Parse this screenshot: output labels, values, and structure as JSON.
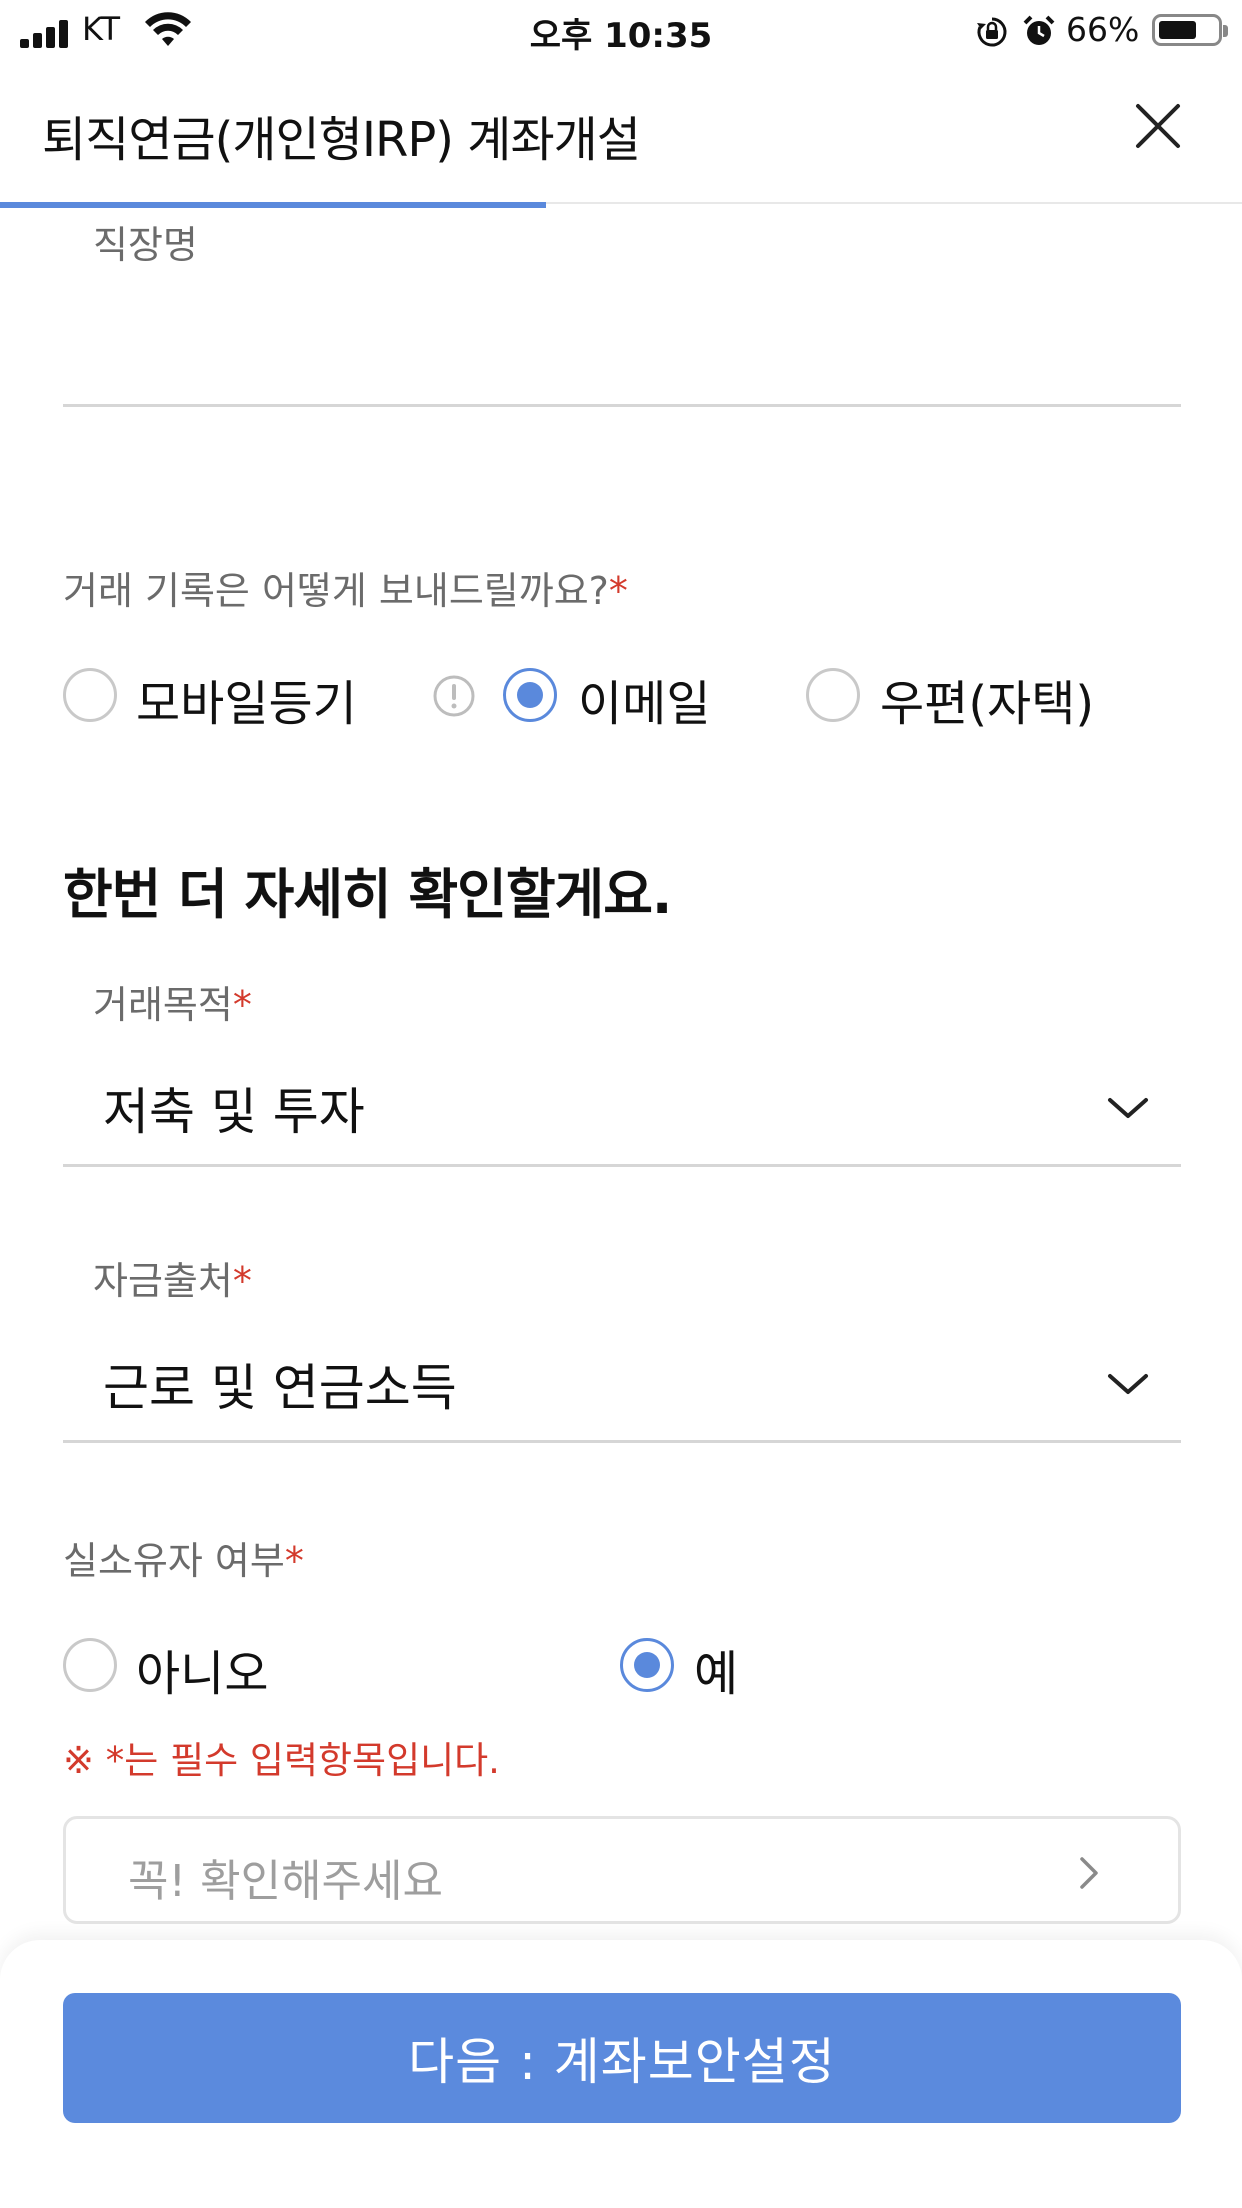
{
  "status_bar": {
    "carrier": "KT",
    "time": "오후 10:35",
    "battery_percent": "66%",
    "battery_level": 0.66,
    "icons": [
      "signal-icon",
      "wifi-icon",
      "rotation-lock-icon",
      "alarm-icon",
      "battery-icon"
    ]
  },
  "header": {
    "title": "퇴직연금(개인형IRP) 계좌개설",
    "close_icon": "close-icon",
    "progress": 0.44
  },
  "form": {
    "workplace": {
      "label": "직장명",
      "value": ""
    },
    "statement_delivery": {
      "question": "거래 기록은 어떻게 보내드릴까요?",
      "required_mark": "*",
      "options": [
        {
          "label": "모바일등기",
          "selected": false
        },
        {
          "label": "이메일",
          "selected": true
        },
        {
          "label": "우편(자택)",
          "selected": false
        }
      ],
      "info_icon": "info-icon"
    },
    "section_heading": "한번 더 자세히 확인할게요.",
    "transaction_purpose": {
      "label": "거래목적",
      "required_mark": "*",
      "value": "저축 및 투자"
    },
    "fund_source": {
      "label": "자금출처",
      "required_mark": "*",
      "value": "근로 및 연금소득"
    },
    "beneficial_owner": {
      "question": "실소유자 여부",
      "required_mark": "*",
      "options": [
        {
          "label": "아니오",
          "selected": false
        },
        {
          "label": "예",
          "selected": true
        }
      ]
    },
    "required_notice": "※ *는 필수 입력항목입니다.",
    "confirm_box": {
      "text": "꼭! 확인해주세요"
    }
  },
  "footer": {
    "next_button_label": "다음 : 계좌보안설정"
  },
  "colors": {
    "accent": "#5a89dc",
    "required": "#d33a2c",
    "label": "#6b6b6b",
    "divider": "#d6d6d6"
  }
}
